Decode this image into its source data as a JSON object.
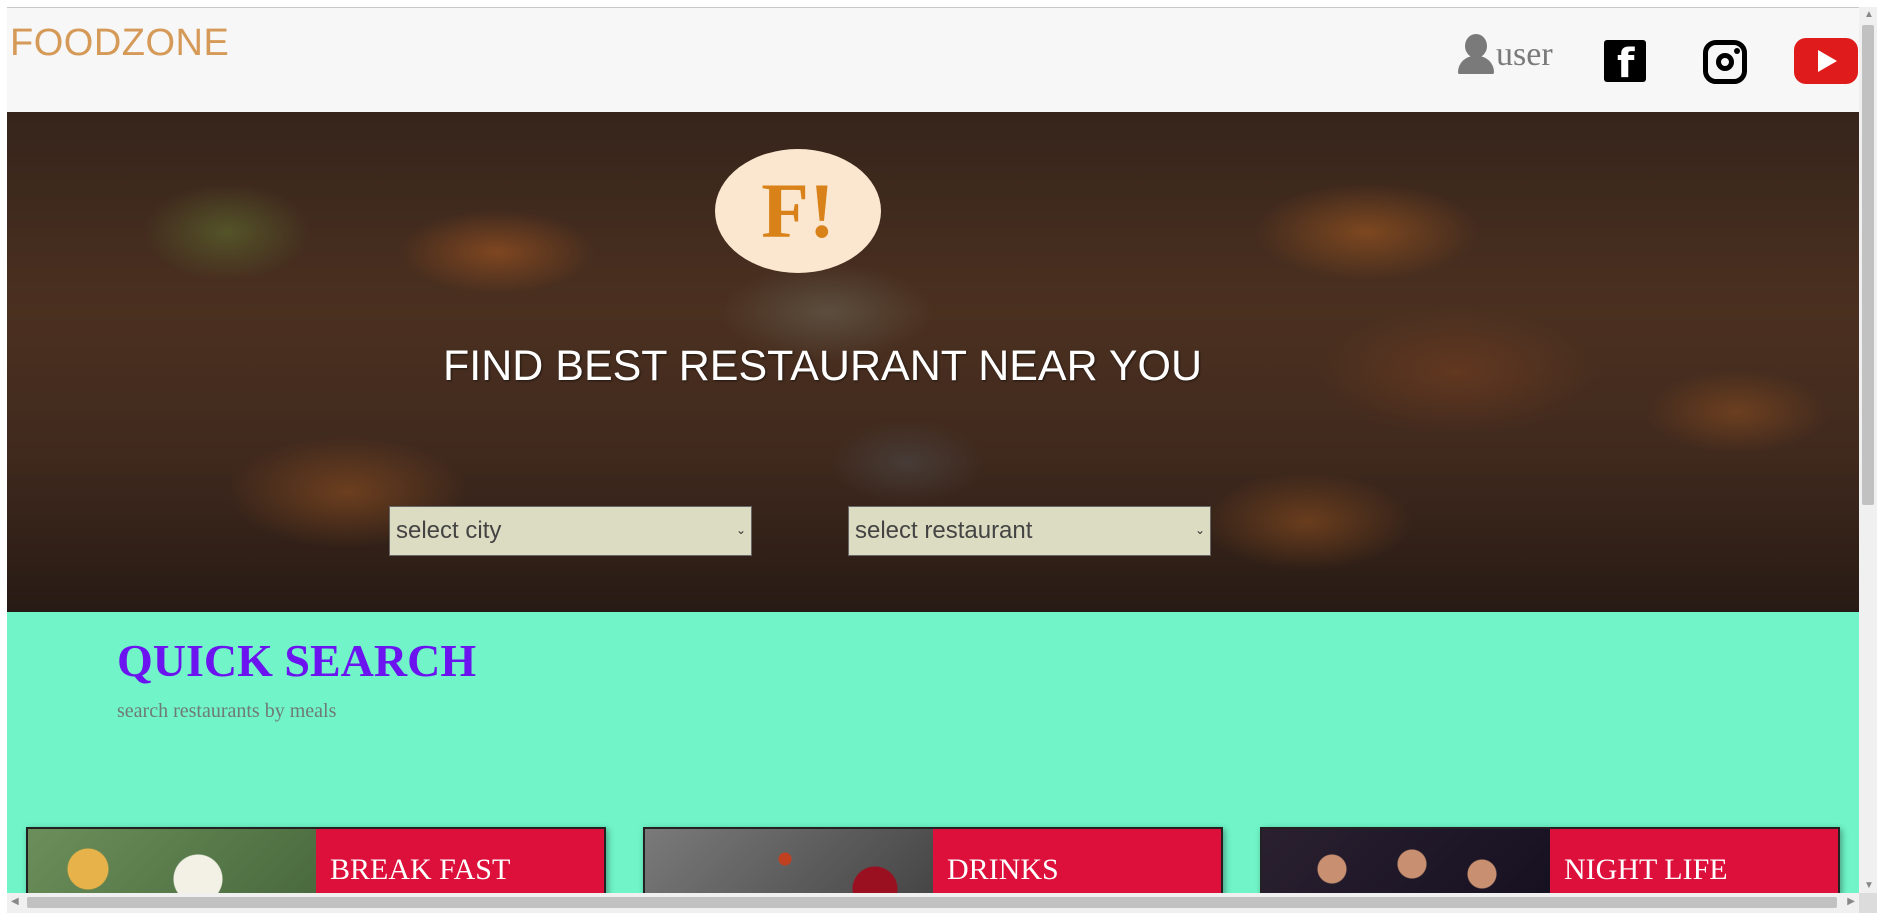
{
  "header": {
    "brand": "FOODZONE",
    "user_label": "user",
    "icons": [
      "user-icon",
      "facebook-icon",
      "instagram-icon",
      "youtube-icon"
    ]
  },
  "hero": {
    "logo_text": "F!",
    "title": "FIND BEST RESTAURANT NEAR YOU",
    "city_select": {
      "selected": "select city"
    },
    "restaurant_select": {
      "selected": "select restaurant"
    }
  },
  "quick_search": {
    "title": "QUICK SEARCH",
    "subtitle": "search restaurants by meals",
    "cards": [
      {
        "label": "BREAK FAST"
      },
      {
        "label": "DRINKS"
      },
      {
        "label": "NIGHT LIFE"
      }
    ]
  },
  "colors": {
    "brand": "#d69a58",
    "quick_bg": "#70f4c8",
    "quick_title": "#6b14f0",
    "card_bg": "#dd103c",
    "select_bg": "#dcdcc2"
  }
}
